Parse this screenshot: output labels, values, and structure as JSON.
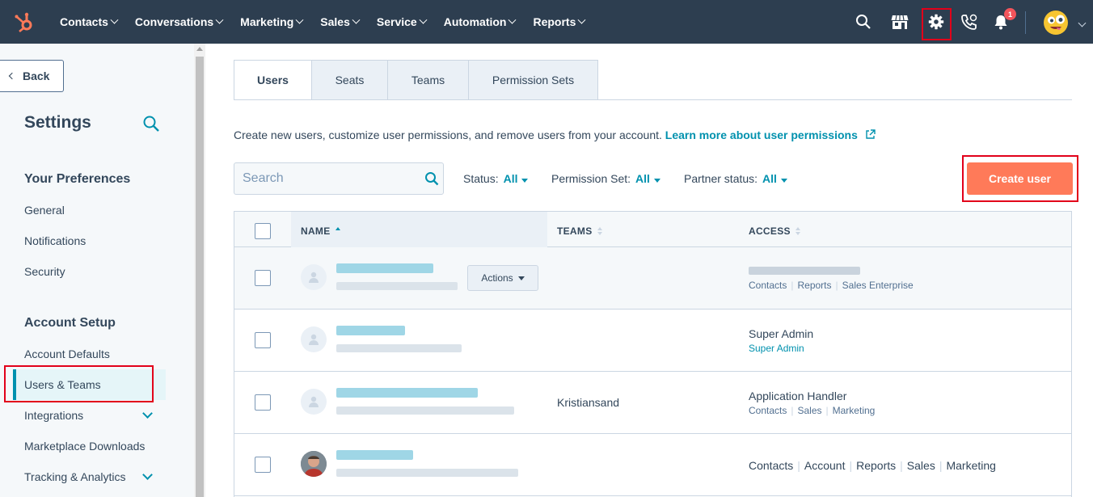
{
  "colors": {
    "nav_bg": "#2d3e50",
    "accent": "#0091ae",
    "primary_btn": "#ff7a59",
    "highlight_box": "#e2001a"
  },
  "topnav": {
    "menu": [
      {
        "label": "Contacts"
      },
      {
        "label": "Conversations"
      },
      {
        "label": "Marketing"
      },
      {
        "label": "Sales"
      },
      {
        "label": "Service"
      },
      {
        "label": "Automation"
      },
      {
        "label": "Reports"
      }
    ],
    "icons": [
      "search-icon",
      "marketplace-icon",
      "settings-gear-icon",
      "calling-icon",
      "notifications-bell-icon",
      "account-avatar"
    ],
    "notification_count": "1"
  },
  "sidebar": {
    "back_label": "Back",
    "title": "Settings",
    "your_preferences": {
      "title": "Your Preferences",
      "items": [
        {
          "label": "General"
        },
        {
          "label": "Notifications"
        },
        {
          "label": "Security"
        }
      ]
    },
    "account_setup": {
      "title": "Account Setup",
      "items": [
        {
          "label": "Account Defaults"
        },
        {
          "label": "Users & Teams",
          "active": true
        },
        {
          "label": "Integrations",
          "expandable": true
        },
        {
          "label": "Marketplace Downloads"
        },
        {
          "label": "Tracking & Analytics",
          "expandable": true
        }
      ]
    }
  },
  "main": {
    "tabs": [
      {
        "label": "Users",
        "active": true
      },
      {
        "label": "Seats"
      },
      {
        "label": "Teams"
      },
      {
        "label": "Permission Sets"
      }
    ],
    "description": "Create new users, customize user permissions, and remove users from your account.",
    "description_link": "Learn more about user permissions",
    "search_placeholder": "Search",
    "filters": [
      {
        "label": "Status:",
        "value": "All"
      },
      {
        "label": "Permission Set:",
        "value": "All"
      },
      {
        "label": "Partner status:",
        "value": "All"
      }
    ],
    "create_button": "Create user"
  },
  "table": {
    "columns": [
      "NAME",
      "TEAMS",
      "ACCESS"
    ],
    "actions_label": "Actions",
    "rows": [
      {
        "team": "",
        "access": "",
        "access_sub": [
          "Contacts",
          "Reports",
          "Sales Enterprise"
        ]
      },
      {
        "team": "",
        "access": "Super Admin",
        "access_sub": [
          "Super Admin"
        ]
      },
      {
        "team": "Kristiansand",
        "access": "Application Handler",
        "access_sub": [
          "Contacts",
          "Sales",
          "Marketing"
        ]
      },
      {
        "team": "",
        "access": "",
        "access_inline": [
          "Contacts",
          "Account",
          "Reports",
          "Sales",
          "Marketing"
        ]
      }
    ]
  }
}
